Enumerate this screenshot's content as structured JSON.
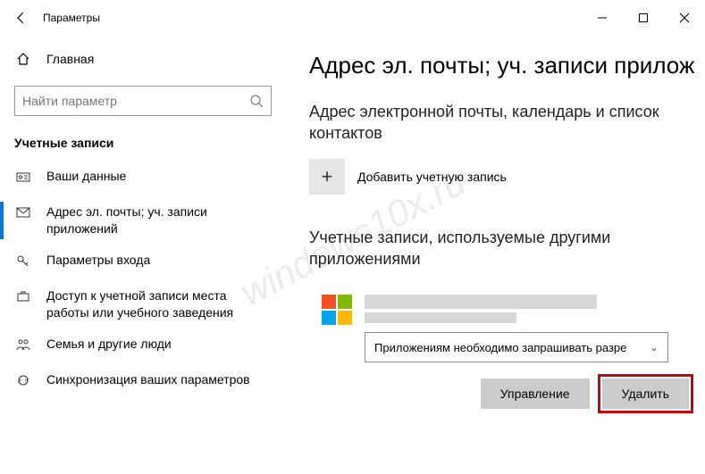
{
  "window": {
    "title": "Параметры"
  },
  "sidebar": {
    "home": "Главная",
    "search_placeholder": "Найти параметр",
    "section": "Учетные записи",
    "items": [
      {
        "label": "Ваши данные"
      },
      {
        "label": "Адрес эл. почты; уч. записи приложений"
      },
      {
        "label": "Параметры входа"
      },
      {
        "label": "Доступ к учетной записи места работы или учебного заведения"
      },
      {
        "label": "Семья и другие люди"
      },
      {
        "label": "Синхронизация ваших параметров"
      }
    ]
  },
  "main": {
    "heading": "Адрес эл. почты; уч. записи прилож",
    "section1": "Адрес электронной почты, календарь и список контактов",
    "add_account": "Добавить учетную запись",
    "section2": "Учетные записи, используемые другими приложениями",
    "dropdown": "Приложениям необходимо запрашивать разре",
    "manage_btn": "Управление",
    "delete_btn": "Удалить"
  },
  "watermark": "windows10x.ru"
}
